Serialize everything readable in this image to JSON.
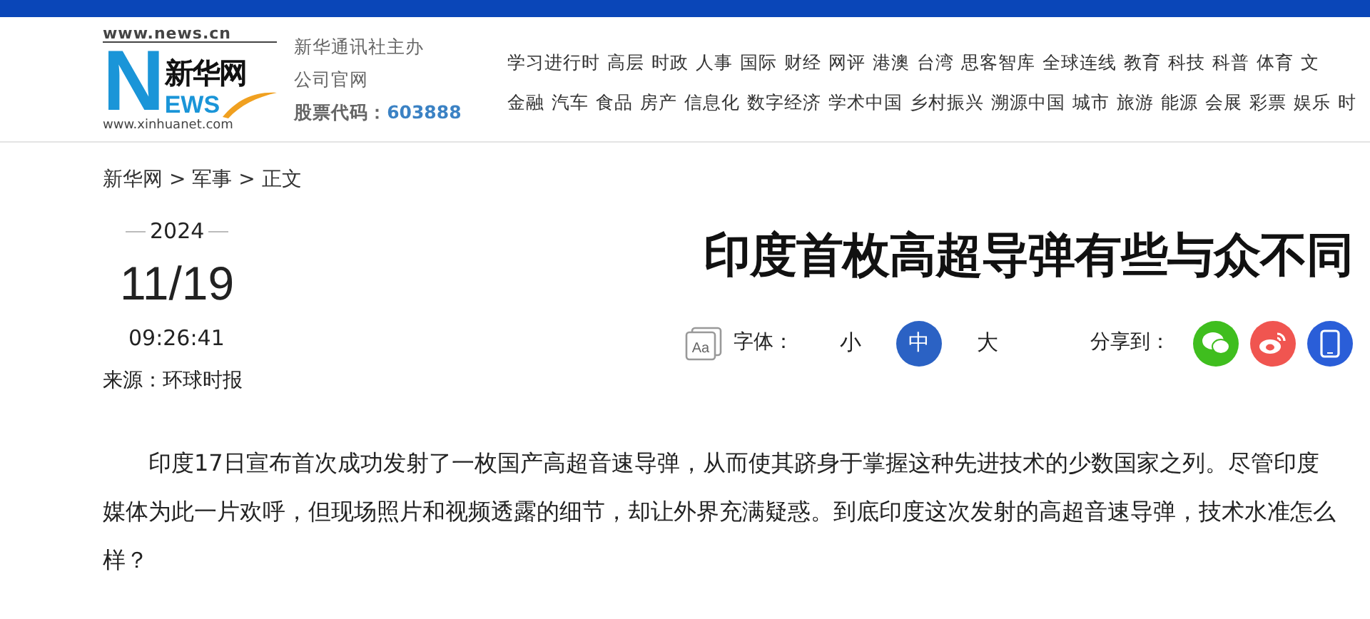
{
  "logo": {
    "top_url": "www.news.cn",
    "letter": "N",
    "name": "新华网",
    "letters": "EWS",
    "bottom_url": "www.xinhuanet.com"
  },
  "org": {
    "line_1": "新华通讯社主办",
    "line_2": "公司官网",
    "stock_label": "股票代码：",
    "stock_code": "603888"
  },
  "nav_rows": [
    [
      "学习进行时",
      "高层",
      "时政",
      "人事",
      "国际",
      "财经",
      "网评",
      "港澳",
      "台湾",
      "思客智库",
      "全球连线",
      "教育",
      "科技",
      "科普",
      "体育",
      "文"
    ],
    [
      "金融",
      "汽车",
      "食品",
      "房产",
      "信息化",
      "数字经济",
      "学术中国",
      "乡村振兴",
      "溯源中国",
      "城市",
      "旅游",
      "能源",
      "会展",
      "彩票",
      "娱乐",
      "时"
    ]
  ],
  "breadcrumb": [
    {
      "label": "新华网"
    },
    {
      "label": "军事"
    },
    {
      "label": "正文"
    }
  ],
  "breadcrumb_separator": ">",
  "date": {
    "year": "2024",
    "day": "11/19",
    "time": "09:26:41"
  },
  "source": "来源：环球时报",
  "title": "印度首枚高超导弹有些与众不同",
  "font_icon_text": "Aa",
  "font_label": "字体：",
  "font_sizes": [
    {
      "label": "小",
      "selected": false
    },
    {
      "label": "中",
      "selected": true
    },
    {
      "label": "大",
      "selected": false
    }
  ],
  "share_label": "分享到：",
  "share": [
    {
      "kind": "wechat",
      "color": "#3fbe1e"
    },
    {
      "kind": "weibo",
      "color": "#f05550"
    },
    {
      "kind": "mobile",
      "color": "#2a5ed8"
    }
  ],
  "body": "印度17日宣布首次成功发射了一枚国产高超音速导弹，从而使其跻身于掌握这种先进技术的少数国家之列。尽管印度媒体为此一片欢呼，但现场照片和视频透露的细节，却让外界充满疑惑。到底印度这次发射的高超音速导弹，技术水准怎么样？"
}
